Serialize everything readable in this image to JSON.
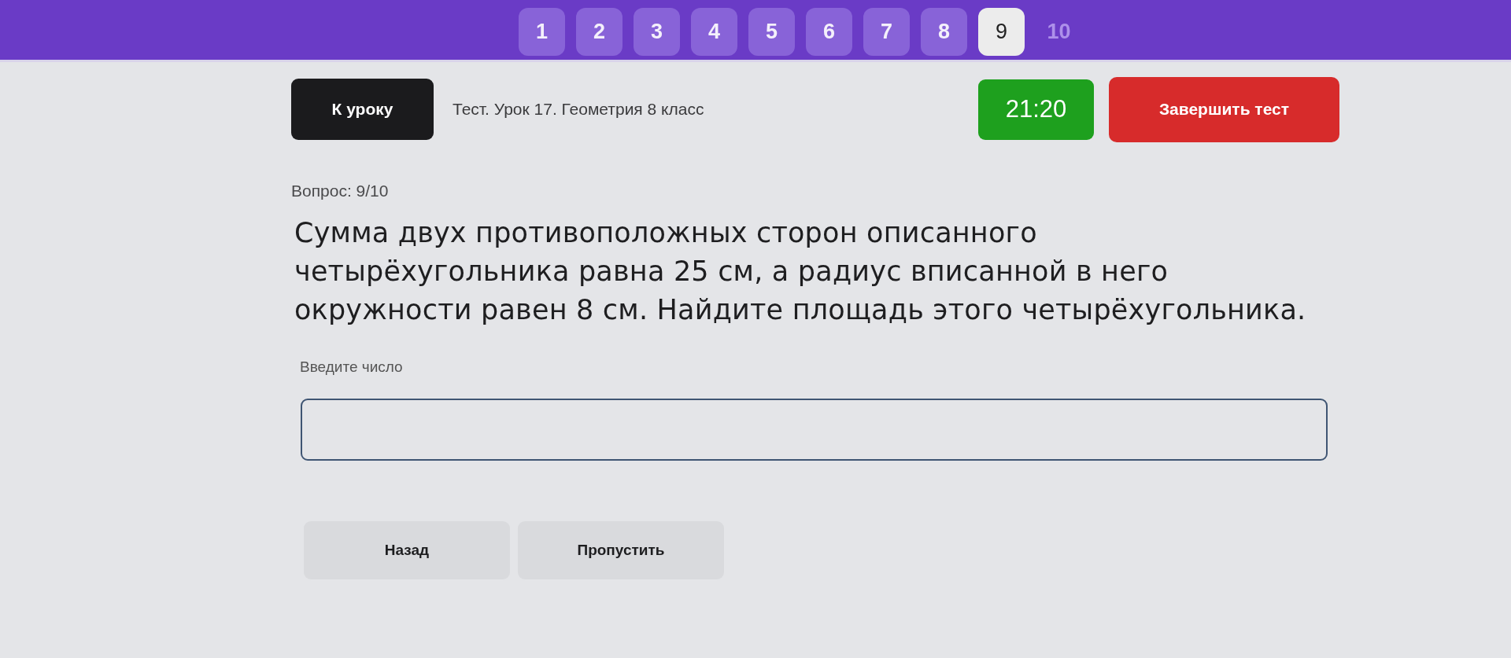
{
  "nav": {
    "questions": [
      {
        "label": "1",
        "answered": true,
        "selected": false
      },
      {
        "label": "2",
        "answered": true,
        "selected": false
      },
      {
        "label": "3",
        "answered": true,
        "selected": false
      },
      {
        "label": "4",
        "answered": true,
        "selected": false
      },
      {
        "label": "5",
        "answered": true,
        "selected": false
      },
      {
        "label": "6",
        "answered": true,
        "selected": false
      },
      {
        "label": "7",
        "answered": true,
        "selected": false
      },
      {
        "label": "8",
        "answered": true,
        "selected": false
      },
      {
        "label": "9",
        "answered": false,
        "selected": true
      },
      {
        "label": "10",
        "answered": false,
        "selected": false
      }
    ]
  },
  "header": {
    "back_button": "К уроку",
    "title": "Тест. Урок 17. Геометрия 8 класс",
    "timer": "21:20",
    "finish_button": "Завершить тест"
  },
  "question": {
    "counter": "Вопрос: 9/10",
    "text": "Сумма двух противоположных сторон описанного четырёхугольника равна 25 см, а радиус вписанной в него окружности равен 8 см. Найдите площадь этого четырёхугольника.",
    "answer_field": {
      "label": "Введите число"
    }
  },
  "footer_buttons": [
    "Назад",
    "Пропустить"
  ]
}
